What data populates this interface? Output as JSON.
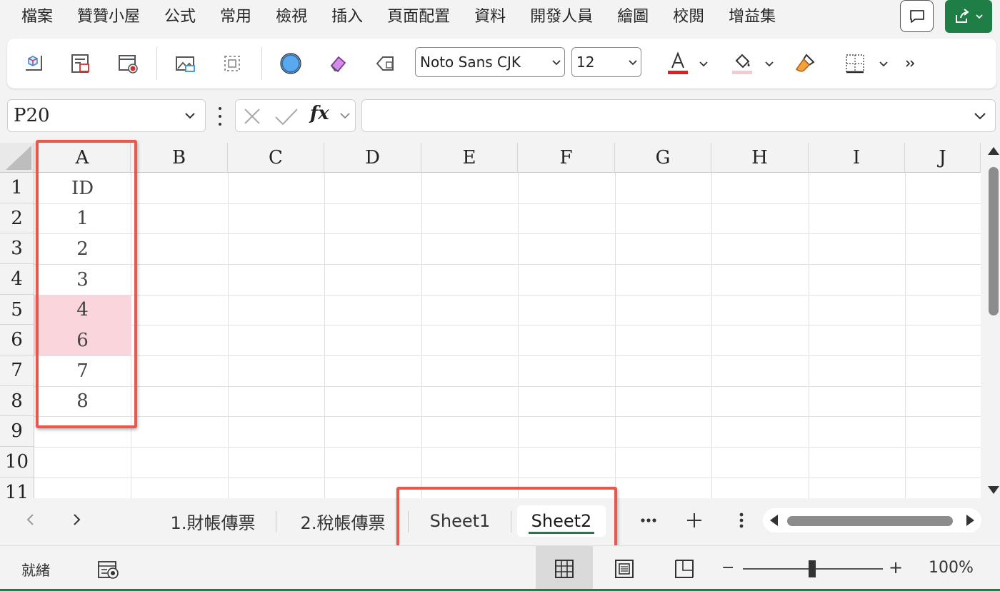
{
  "menu": [
    "檔案",
    "贊贊小屋",
    "公式",
    "常用",
    "檢視",
    "插入",
    "頁面配置",
    "資料",
    "開發人員",
    "繪圖",
    "校閱",
    "增益集"
  ],
  "ribbon": {
    "font_name": "Noto Sans CJK",
    "font_size": "12",
    "font_color": "#e02020",
    "fill_color": "#f6c9d1"
  },
  "formula_bar": {
    "name_box": "P20",
    "fx_label": "fx",
    "formula": ""
  },
  "columns": [
    "A",
    "B",
    "C",
    "D",
    "E",
    "F",
    "G",
    "H",
    "I",
    "J"
  ],
  "rows": [
    "1",
    "2",
    "3",
    "4",
    "5",
    "6",
    "7",
    "8",
    "9",
    "10",
    "11"
  ],
  "column_a": [
    "ID",
    "1",
    "2",
    "3",
    "4",
    "6",
    "7",
    "8",
    "",
    "",
    ""
  ],
  "highlighted_rows": [
    "5",
    "6"
  ],
  "sheet_tabs": [
    {
      "label": "1.財帳傳票",
      "active": false
    },
    {
      "label": "2.稅帳傳票",
      "active": false
    },
    {
      "label": "Sheet1",
      "active": false
    },
    {
      "label": "Sheet2",
      "active": true
    }
  ],
  "status": {
    "ready": "就緒",
    "zoom": "100%"
  },
  "colors": {
    "accent_green": "#1e7e45",
    "highlight_pink": "#fad5dc",
    "annotation_red": "#e8584c"
  }
}
